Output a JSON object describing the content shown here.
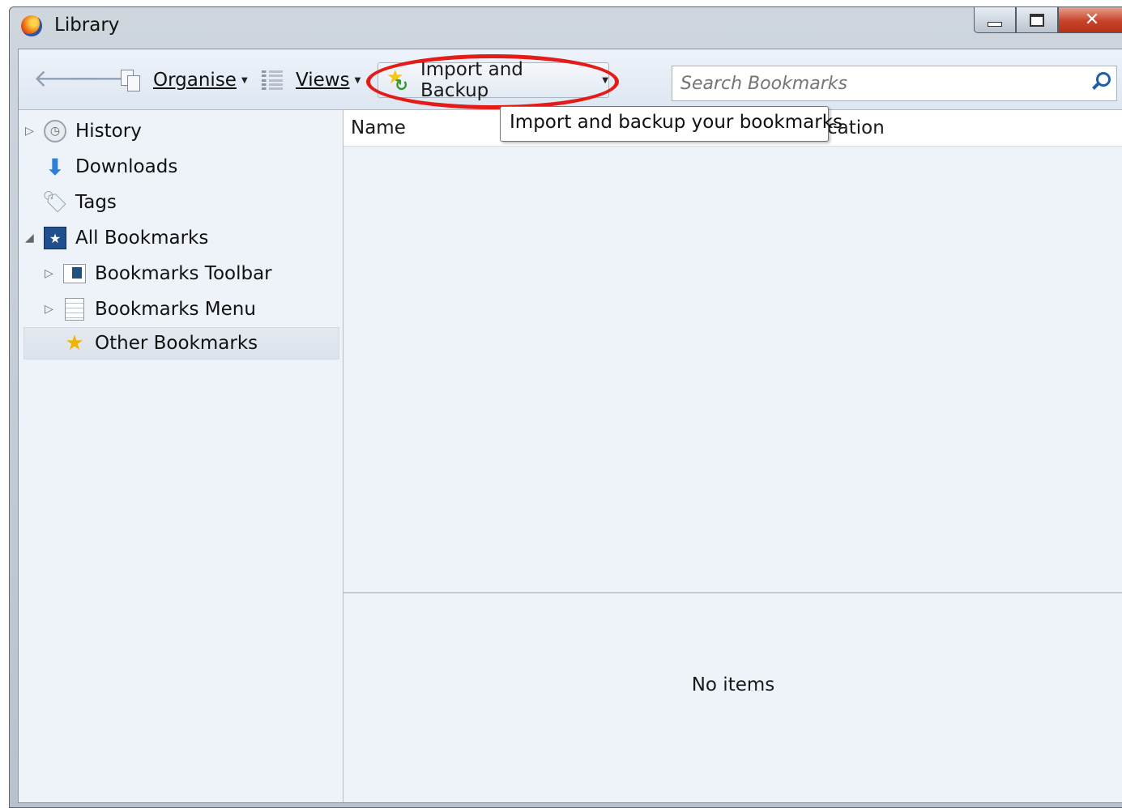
{
  "window": {
    "title": "Library"
  },
  "toolbar": {
    "organise_label": "Organise",
    "views_label": "Views",
    "import_backup_label": "Import and Backup",
    "search_placeholder": "Search Bookmarks"
  },
  "tooltip": {
    "text": "Import and backup your bookmarks"
  },
  "sidebar": {
    "items": [
      {
        "label": "History",
        "icon": "history-clock-icon"
      },
      {
        "label": "Downloads",
        "icon": "download-arrow-icon"
      },
      {
        "label": "Tags",
        "icon": "tag-icon"
      },
      {
        "label": "All Bookmarks",
        "icon": "bookmarks-star-icon"
      },
      {
        "label": "Bookmarks Toolbar",
        "icon": "bookmarks-toolbar-icon"
      },
      {
        "label": "Bookmarks Menu",
        "icon": "bookmarks-menu-icon"
      },
      {
        "label": "Other Bookmarks",
        "icon": "other-bookmarks-icon"
      }
    ],
    "selected": "Other Bookmarks"
  },
  "content": {
    "columns": [
      "Name",
      "Location"
    ],
    "location_visible_fragment": "cation",
    "empty_text": "No items"
  },
  "colors": {
    "highlight_ring": "#e41b17",
    "pane_background": "#eef3fa",
    "close_button": "#c8432a"
  }
}
